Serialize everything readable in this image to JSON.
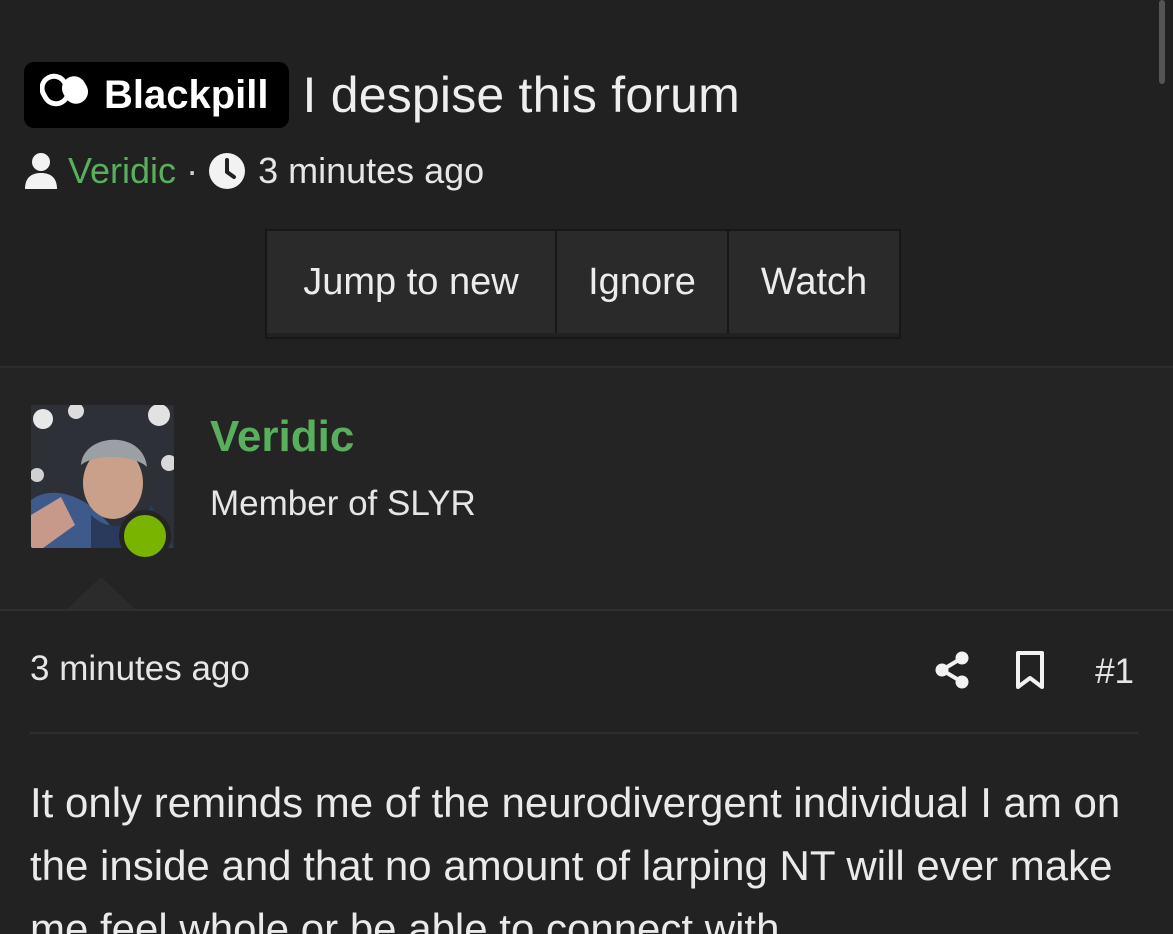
{
  "thread": {
    "prefix": "Blackpill",
    "prefix_icon": "pills-icon",
    "title": "I despise this forum",
    "author": "Veridic",
    "separator": "·",
    "time": "3 minutes ago"
  },
  "actions": {
    "jump_label": "Jump to new",
    "ignore_label": "Ignore",
    "watch_label": "Watch"
  },
  "post": {
    "username": "Veridic",
    "user_title": "Member of SLYR",
    "online": true,
    "time": "3 minutes ago",
    "number": "#1",
    "message": "It only reminds me of the neurodivergent individual I am on the inside and that no amount of larping NT will ever make me feel whole or be able to connect with"
  },
  "colors": {
    "background": "#232323",
    "username": "#58b05c",
    "badge": "#000000",
    "online": "#79b400"
  }
}
